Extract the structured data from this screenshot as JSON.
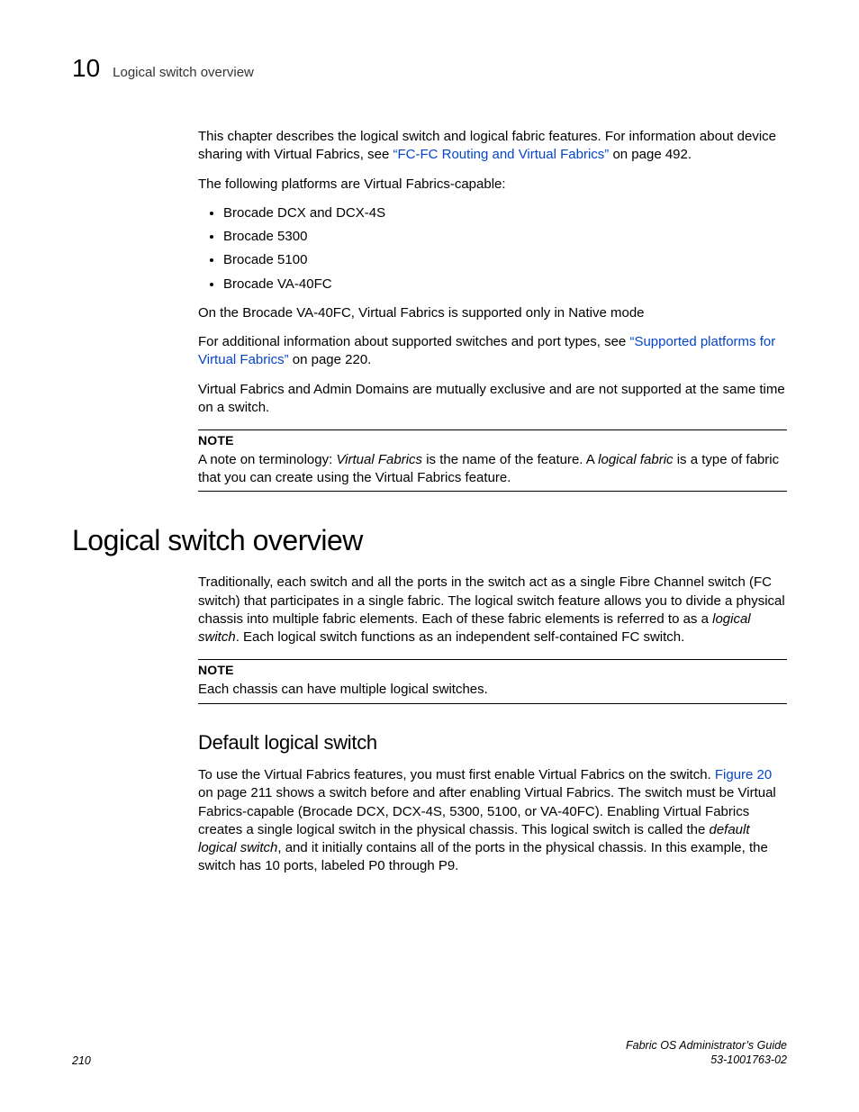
{
  "header": {
    "chapter_number": "10",
    "title": "Logical switch overview"
  },
  "intro": {
    "p1a": "This chapter describes the logical switch and logical fabric features. For information about device sharing with Virtual Fabrics, see ",
    "p1_link": "“FC-FC Routing and Virtual Fabrics”",
    "p1b": " on page 492.",
    "p2": "The following platforms are Virtual Fabrics-capable:",
    "bullets": [
      "Brocade DCX and DCX-4S",
      "Brocade 5300",
      "Brocade 5100",
      "Brocade VA-40FC"
    ],
    "p3": "On the Brocade VA-40FC, Virtual Fabrics is supported only in Native mode",
    "p4a": "For additional information about supported switches and port types, see ",
    "p4_link": "“Supported platforms for Virtual Fabrics”",
    "p4b": " on page 220.",
    "p5": "Virtual Fabrics and Admin Domains are mutually exclusive and are not supported at the same time on a switch.",
    "note_label": "NOTE",
    "note_a": "A note on terminology: ",
    "note_em1": "Virtual Fabrics",
    "note_b": " is the name of the feature. A ",
    "note_em2": "logical fabric",
    "note_c": " is a type of fabric that you can create using the Virtual Fabrics feature."
  },
  "section": {
    "h1": "Logical switch overview",
    "p1a": "Traditionally, each switch and all the ports in the switch act as a single Fibre Channel switch (FC switch) that participates in a single fabric. The logical switch feature allows you to divide a physical chassis into multiple fabric elements. Each of these fabric elements is referred to as a ",
    "p1_em": "logical switch",
    "p1b": ". Each logical switch functions as an independent self-contained FC switch.",
    "note_label": "NOTE",
    "note_text": "Each chassis can have multiple logical switches.",
    "h2": "Default logical switch",
    "p2a": "To use the Virtual Fabrics features, you must first enable Virtual Fabrics on the switch. ",
    "p2_link": "Figure 20",
    "p2b": " on page 211 shows a switch before and after enabling Virtual Fabrics. The switch must be Virtual Fabrics-capable (Brocade DCX, DCX-4S, 5300, 5100, or VA-40FC). Enabling Virtual Fabrics creates a single logical switch in the physical chassis. This logical switch is called the ",
    "p2_em": "default logical switch",
    "p2c": ", and it initially contains all of the ports in the physical chassis. In this example, the switch has 10 ports, labeled P0 through P9."
  },
  "footer": {
    "page": "210",
    "guide": "Fabric OS Administrator’s Guide",
    "docnum": "53-1001763-02"
  }
}
